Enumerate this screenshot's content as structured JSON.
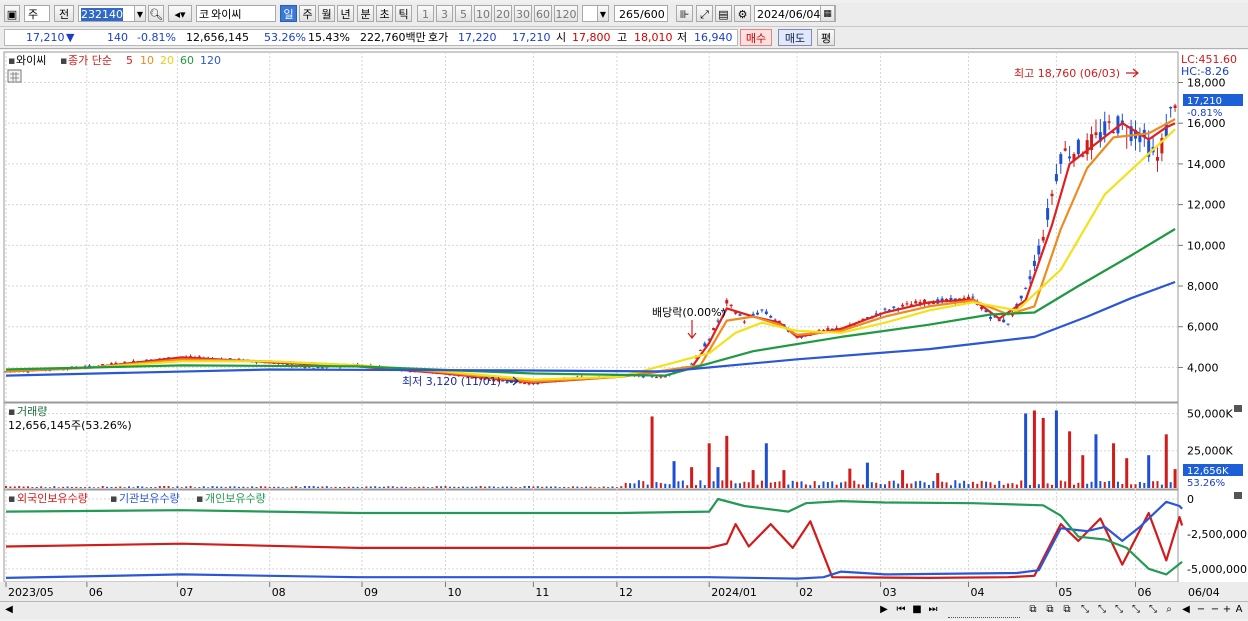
{
  "toolbar": {
    "market": "주",
    "prev_label": "전",
    "code": "232140",
    "code_prefix": "코",
    "name": "와이씨",
    "periods": [
      "일",
      "주",
      "월",
      "년",
      "분",
      "초",
      "틱"
    ],
    "active_period": "일",
    "intervals": [
      "1",
      "3",
      "5",
      "10",
      "20",
      "30",
      "60",
      "120"
    ],
    "count": "265",
    "count_total": "/600",
    "date": "2024/06/04"
  },
  "quote": {
    "price": "17,210",
    "arrow": "▼",
    "change": "140",
    "change_pct": "-0.81%",
    "volume": "12,656,145",
    "volume_ratio": "53.26%",
    "turnover": "15.43%",
    "amount": "222,760백만",
    "ask_label": "호가",
    "ask": "17,220",
    "bid": "17,210",
    "open_label": "시",
    "open": "17,800",
    "high_label": "고",
    "high": "18,010",
    "low_label": "저",
    "low": "16,940",
    "buy": "매수",
    "sell": "매도",
    "eval": "평"
  },
  "price_panel": {
    "title": "와이씨",
    "ma_label": "종가 단순",
    "ma_periods": [
      {
        "label": "5",
        "color": "#e02020"
      },
      {
        "label": "10",
        "color": "#ee8a1e"
      },
      {
        "label": "20",
        "color": "#f2e21a"
      },
      {
        "label": "60",
        "color": "#1f9a40"
      },
      {
        "label": "120",
        "color": "#2b57d6"
      }
    ],
    "lc": "LC:451.60",
    "hc": "HC:-8.26",
    "cur_price": "17,210",
    "cur_pct": "-0.81%",
    "max_note": "최고 18,760 (06/03)",
    "min_note": "최저 3,120 (11/01)",
    "div_note": "배당락(0.00%)"
  },
  "volume_panel": {
    "title": "거래량",
    "value_text": "12,656,145주(53.26%)",
    "cur_label": "12,656K",
    "cur_pct": "53.26%"
  },
  "holding_panel": {
    "series": [
      {
        "name": "외국인보유수량",
        "color": "#d21b1b"
      },
      {
        "name": "기관보유수량",
        "color": "#2b57d6"
      },
      {
        "name": "개인보유수량",
        "color": "#239a55"
      }
    ]
  },
  "chart_data": {
    "type": "line",
    "x_ticks": [
      "2023/05",
      "06",
      "07",
      "08",
      "09",
      "10",
      "11",
      "12",
      "2024/01",
      "02",
      "03",
      "04",
      "05",
      "06",
      "06/04"
    ],
    "price_axis": {
      "ticks": [
        "4,000",
        "6,000",
        "8,000",
        "10,000",
        "12,000",
        "14,000",
        "16,000",
        "18,000"
      ],
      "ylim": [
        2400,
        19400
      ]
    },
    "volume_axis": {
      "ticks": [
        "25,000K",
        "50,000K"
      ],
      "ylim": [
        0,
        55000000
      ]
    },
    "holding_axis": {
      "ticks": [
        "0",
        "-2,500,000",
        "-5,000,000"
      ],
      "ylim": [
        -5800000,
        500000
      ]
    },
    "close": [
      {
        "m": 0,
        "v": 3800
      },
      {
        "m": 0.5,
        "v": 3900
      },
      {
        "m": 1,
        "v": 4050
      },
      {
        "m": 1.5,
        "v": 4300
      },
      {
        "m": 2,
        "v": 4500
      },
      {
        "m": 2.5,
        "v": 4400
      },
      {
        "m": 3,
        "v": 4250
      },
      {
        "m": 3.5,
        "v": 3950
      },
      {
        "m": 4,
        "v": 4150
      },
      {
        "m": 4.5,
        "v": 3900
      },
      {
        "m": 5,
        "v": 3700
      },
      {
        "m": 5.5,
        "v": 3400
      },
      {
        "m": 6,
        "v": 3200
      },
      {
        "m": 6.5,
        "v": 3500
      },
      {
        "m": 7,
        "v": 3600
      },
      {
        "m": 7.5,
        "v": 3550
      },
      {
        "m": 7.8,
        "v": 4200
      },
      {
        "m": 8,
        "v": 5400
      },
      {
        "m": 8.2,
        "v": 7200
      },
      {
        "m": 8.4,
        "v": 6300
      },
      {
        "m": 8.6,
        "v": 6800
      },
      {
        "m": 8.8,
        "v": 6200
      },
      {
        "m": 9,
        "v": 5500
      },
      {
        "m": 9.3,
        "v": 5800
      },
      {
        "m": 9.6,
        "v": 6000
      },
      {
        "m": 10,
        "v": 6800
      },
      {
        "m": 10.4,
        "v": 7200
      },
      {
        "m": 10.8,
        "v": 7300
      },
      {
        "m": 11,
        "v": 7400
      },
      {
        "m": 11.2,
        "v": 6500
      },
      {
        "m": 11.4,
        "v": 6200
      },
      {
        "m": 11.6,
        "v": 7800
      },
      {
        "m": 11.8,
        "v": 10500
      },
      {
        "m": 12,
        "v": 14500
      },
      {
        "m": 12.3,
        "v": 14800
      },
      {
        "m": 12.6,
        "v": 16000
      },
      {
        "m": 12.9,
        "v": 15500
      },
      {
        "m": 13.1,
        "v": 14200
      },
      {
        "m": 13.3,
        "v": 17210
      }
    ],
    "series": [
      {
        "name": "5",
        "values": [
          [
            0,
            3800
          ],
          [
            1,
            4000
          ],
          [
            2,
            4500
          ],
          [
            3,
            4250
          ],
          [
            4,
            4050
          ],
          [
            5,
            3700
          ],
          [
            6,
            3250
          ],
          [
            7,
            3550
          ],
          [
            7.8,
            4000
          ],
          [
            8,
            5200
          ],
          [
            8.2,
            6900
          ],
          [
            8.5,
            6500
          ],
          [
            8.8,
            6200
          ],
          [
            9,
            5500
          ],
          [
            9.5,
            5900
          ],
          [
            10,
            6700
          ],
          [
            10.5,
            7200
          ],
          [
            11,
            7350
          ],
          [
            11.3,
            6400
          ],
          [
            11.6,
            7300
          ],
          [
            11.9,
            11000
          ],
          [
            12.1,
            14000
          ],
          [
            12.4,
            15000
          ],
          [
            12.7,
            16000
          ],
          [
            13,
            15200
          ],
          [
            13.2,
            15800
          ],
          [
            13.3,
            16000
          ]
        ]
      },
      {
        "name": "10",
        "values": [
          [
            0,
            3800
          ],
          [
            1,
            4000
          ],
          [
            2,
            4400
          ],
          [
            3,
            4300
          ],
          [
            4,
            4100
          ],
          [
            5,
            3750
          ],
          [
            6,
            3300
          ],
          [
            7,
            3550
          ],
          [
            7.9,
            4100
          ],
          [
            8.2,
            6300
          ],
          [
            8.5,
            6500
          ],
          [
            8.8,
            6100
          ],
          [
            9,
            5600
          ],
          [
            9.5,
            5800
          ],
          [
            10,
            6500
          ],
          [
            10.5,
            7000
          ],
          [
            11,
            7300
          ],
          [
            11.4,
            6600
          ],
          [
            11.7,
            7000
          ],
          [
            12,
            10800
          ],
          [
            12.3,
            13800
          ],
          [
            12.6,
            15300
          ],
          [
            13,
            15500
          ],
          [
            13.3,
            16200
          ]
        ]
      },
      {
        "name": "20",
        "values": [
          [
            0,
            3900
          ],
          [
            1,
            4000
          ],
          [
            2,
            4300
          ],
          [
            3,
            4300
          ],
          [
            4,
            4100
          ],
          [
            5,
            3800
          ],
          [
            6,
            3400
          ],
          [
            7,
            3550
          ],
          [
            8,
            4700
          ],
          [
            8.3,
            5700
          ],
          [
            8.6,
            6200
          ],
          [
            9,
            5800
          ],
          [
            9.5,
            5700
          ],
          [
            10,
            6200
          ],
          [
            10.5,
            6800
          ],
          [
            11,
            7200
          ],
          [
            11.5,
            6800
          ],
          [
            12,
            8800
          ],
          [
            12.5,
            12500
          ],
          [
            13,
            14500
          ],
          [
            13.3,
            15700
          ]
        ]
      },
      {
        "name": "60",
        "values": [
          [
            0,
            3900
          ],
          [
            2,
            4100
          ],
          [
            4,
            4050
          ],
          [
            6,
            3700
          ],
          [
            7.5,
            3600
          ],
          [
            8.5,
            4800
          ],
          [
            9.5,
            5500
          ],
          [
            10.5,
            6100
          ],
          [
            11.2,
            6600
          ],
          [
            11.7,
            6700
          ],
          [
            12.2,
            8000
          ],
          [
            12.8,
            9500
          ],
          [
            13.3,
            10800
          ]
        ]
      },
      {
        "name": "120",
        "values": [
          [
            0,
            3600
          ],
          [
            3,
            3900
          ],
          [
            6,
            3850
          ],
          [
            7.5,
            3800
          ],
          [
            9,
            4400
          ],
          [
            10.5,
            4900
          ],
          [
            11.7,
            5500
          ],
          [
            12.3,
            6500
          ],
          [
            12.8,
            7400
          ],
          [
            13.3,
            8200
          ]
        ]
      }
    ],
    "volume_bars": [
      {
        "m": 7.35,
        "v": 48000000
      },
      {
        "m": 7.6,
        "v": 18000000
      },
      {
        "m": 7.8,
        "v": 14000000
      },
      {
        "m": 8.0,
        "v": 30000000
      },
      {
        "m": 8.1,
        "v": 14000000
      },
      {
        "m": 8.2,
        "v": 35000000
      },
      {
        "m": 8.5,
        "v": 12000000
      },
      {
        "m": 8.65,
        "v": 30000000
      },
      {
        "m": 8.85,
        "v": 12000000
      },
      {
        "m": 9.6,
        "v": 13000000
      },
      {
        "m": 9.8,
        "v": 17000000
      },
      {
        "m": 10.2,
        "v": 12000000
      },
      {
        "m": 10.6,
        "v": 10000000
      },
      {
        "m": 11.6,
        "v": 50000000
      },
      {
        "m": 11.7,
        "v": 52000000
      },
      {
        "m": 11.8,
        "v": 47000000
      },
      {
        "m": 11.95,
        "v": 52000000
      },
      {
        "m": 12.1,
        "v": 38000000
      },
      {
        "m": 12.25,
        "v": 22000000
      },
      {
        "m": 12.4,
        "v": 36000000
      },
      {
        "m": 12.6,
        "v": 30000000
      },
      {
        "m": 12.75,
        "v": 20000000
      },
      {
        "m": 13.0,
        "v": 22000000
      },
      {
        "m": 13.2,
        "v": 36000000
      },
      {
        "m": 13.3,
        "v": 12656145
      }
    ],
    "holding_series": [
      {
        "name": "외국인보유수량",
        "values": [
          [
            0,
            -3400000
          ],
          [
            2,
            -3200000
          ],
          [
            4,
            -3500000
          ],
          [
            6,
            -3500000
          ],
          [
            8,
            -3500000
          ],
          [
            8.2,
            -3200000
          ],
          [
            8.3,
            -1800000
          ],
          [
            8.45,
            -3400000
          ],
          [
            8.7,
            -1800000
          ],
          [
            8.95,
            -3500000
          ],
          [
            9.15,
            -1600000
          ],
          [
            9.4,
            -5600000
          ],
          [
            10.5,
            -5650000
          ],
          [
            11.4,
            -5600000
          ],
          [
            11.7,
            -5500000
          ],
          [
            12.0,
            -1800000
          ],
          [
            12.2,
            -3000000
          ],
          [
            12.45,
            -1400000
          ],
          [
            12.7,
            -4700000
          ],
          [
            13.0,
            -1000000
          ],
          [
            13.2,
            -4400000
          ],
          [
            13.35,
            -1300000
          ],
          [
            13.38,
            -1900000
          ]
        ]
      },
      {
        "name": "기관보유수량",
        "values": [
          [
            0,
            -5650000
          ],
          [
            2,
            -5400000
          ],
          [
            4,
            -5600000
          ],
          [
            8,
            -5600000
          ],
          [
            9,
            -5700000
          ],
          [
            9.3,
            -5600000
          ],
          [
            9.5,
            -5200000
          ],
          [
            10,
            -5400000
          ],
          [
            11.5,
            -5300000
          ],
          [
            11.75,
            -5100000
          ],
          [
            12.0,
            -2100000
          ],
          [
            12.3,
            -2300000
          ],
          [
            12.5,
            -2000000
          ],
          [
            12.7,
            -3000000
          ],
          [
            12.9,
            -2000000
          ],
          [
            13.2,
            -200000
          ],
          [
            13.35,
            -500000
          ],
          [
            13.38,
            -700000
          ]
        ]
      },
      {
        "name": "개인보유수량",
        "values": [
          [
            0,
            -900000
          ],
          [
            2,
            -800000
          ],
          [
            4,
            -1000000
          ],
          [
            7,
            -1000000
          ],
          [
            8,
            -900000
          ],
          [
            8.1,
            0
          ],
          [
            8.4,
            -500000
          ],
          [
            8.9,
            -900000
          ],
          [
            9.1,
            -300000
          ],
          [
            9.5,
            -150000
          ],
          [
            10,
            -250000
          ],
          [
            11,
            -300000
          ],
          [
            11.8,
            -450000
          ],
          [
            12.0,
            -1200000
          ],
          [
            12.2,
            -2700000
          ],
          [
            12.5,
            -2900000
          ],
          [
            12.75,
            -3500000
          ],
          [
            13.0,
            -5000000
          ],
          [
            13.2,
            -5400000
          ],
          [
            13.38,
            -4500000
          ]
        ]
      }
    ]
  }
}
